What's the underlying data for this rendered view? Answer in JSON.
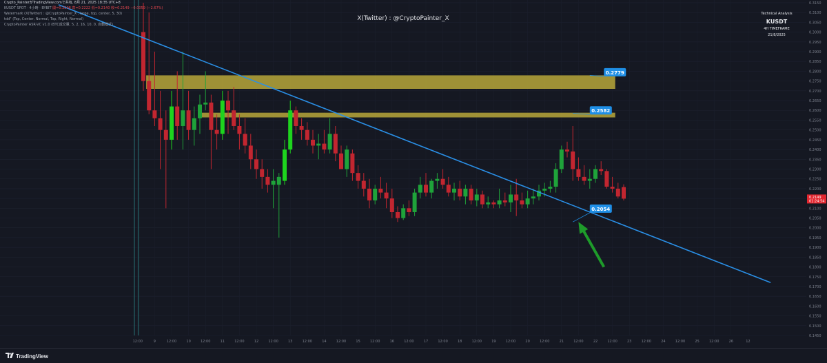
{
  "header": {
    "publisher": "Crypto_PainterがTradingView.comで共有, 8月 21, 2025 18:35 UTC+8",
    "symbol_line": "KUSDT SPOT · 4小時 · BYBIT",
    "ohlc": "開=0.2208 高=0.2222 低=0.2140 收=0.2149 −0.0059 (−2.67%)",
    "indicator_1": "Watermark (X(Twitter) : @CryptoPainter_X , large, top, center, 5, 30)",
    "indicator_2": "tdd\" (Top, Center, Normal, Top, Right, Normal)",
    "indicator_3": "CryptoPainter ASR-VC v1.0 (BTC成交量, 5, 2, 16, 10, 0, 自動模式)"
  },
  "watermark": "X(Twitter) : @CryptoPainter_X",
  "ta_box": {
    "title": "Technical Analysis",
    "symbol": "KUSDT",
    "timeframe": "4H TIMEFRAME",
    "date": "21/8/2025"
  },
  "footer": {
    "brand": "TradingView",
    "logo_icon": "tradingview-logo-icon"
  },
  "colors": {
    "up": "#1fa33a",
    "up_bright": "#1ed41e",
    "down": "#c22630",
    "trendline": "#2a8fe6",
    "zone": "#b7a73a",
    "label_bg": "#1f8fe6",
    "price_tag": "#e3262f",
    "arrow": "#1e9b2a"
  },
  "chart_data": {
    "type": "candlestick",
    "title": "",
    "ylim": [
      0.145,
      0.3164
    ],
    "y_ticks": [
      0.145,
      0.15,
      0.155,
      0.16,
      0.165,
      0.17,
      0.175,
      0.18,
      0.185,
      0.19,
      0.195,
      0.2,
      0.205,
      0.21,
      0.215,
      0.22,
      0.225,
      0.23,
      0.235,
      0.24,
      0.245,
      0.25,
      0.255,
      0.26,
      0.265,
      0.27,
      0.275,
      0.28,
      0.285,
      0.29,
      0.295,
      0.3,
      0.305,
      0.31,
      0.315
    ],
    "x_ticks": [
      {
        "label": "12:00",
        "idx": -1
      },
      {
        "label": "9",
        "idx": 2
      },
      {
        "label": "12:00",
        "idx": 5
      },
      {
        "label": "10",
        "idx": 8
      },
      {
        "label": "12:00",
        "idx": 11
      },
      {
        "label": "11",
        "idx": 14
      },
      {
        "label": "12:00",
        "idx": 17
      },
      {
        "label": "12",
        "idx": 20
      },
      {
        "label": "12:00",
        "idx": 23
      },
      {
        "label": "13",
        "idx": 26
      },
      {
        "label": "12:00",
        "idx": 29
      },
      {
        "label": "14",
        "idx": 32
      },
      {
        "label": "12:00",
        "idx": 35
      },
      {
        "label": "15",
        "idx": 38
      },
      {
        "label": "12:00",
        "idx": 41
      },
      {
        "label": "16",
        "idx": 44
      },
      {
        "label": "12:00",
        "idx": 47
      },
      {
        "label": "17",
        "idx": 50
      },
      {
        "label": "12:00",
        "idx": 53
      },
      {
        "label": "18",
        "idx": 56
      },
      {
        "label": "12:00",
        "idx": 59
      },
      {
        "label": "19",
        "idx": 62
      },
      {
        "label": "12:00",
        "idx": 65
      },
      {
        "label": "20",
        "idx": 68
      },
      {
        "label": "12:00",
        "idx": 71
      },
      {
        "label": "21",
        "idx": 74
      },
      {
        "label": "12:00",
        "idx": 77
      },
      {
        "label": "22",
        "idx": 80
      },
      {
        "label": "12:00",
        "idx": 83
      },
      {
        "label": "23",
        "idx": 86
      },
      {
        "label": "12:00",
        "idx": 89
      },
      {
        "label": "24",
        "idx": 92
      },
      {
        "label": "12:00",
        "idx": 95
      },
      {
        "label": "25",
        "idx": 98
      },
      {
        "label": "12:00",
        "idx": 101
      },
      {
        "label": "26",
        "idx": 104
      },
      {
        "label": "12",
        "idx": 107
      }
    ],
    "candles": [
      {
        "o": 0.3,
        "h": 0.315,
        "l": 0.27,
        "c": 0.275
      },
      {
        "o": 0.275,
        "h": 0.31,
        "l": 0.258,
        "c": 0.26
      },
      {
        "o": 0.26,
        "h": 0.29,
        "l": 0.252,
        "c": 0.256
      },
      {
        "o": 0.256,
        "h": 0.27,
        "l": 0.23,
        "c": 0.25
      },
      {
        "o": 0.25,
        "h": 0.26,
        "l": 0.21,
        "c": 0.245
      },
      {
        "o": 0.245,
        "h": 0.27,
        "l": 0.24,
        "c": 0.262
      },
      {
        "o": 0.262,
        "h": 0.28,
        "l": 0.245,
        "c": 0.252
      },
      {
        "o": 0.252,
        "h": 0.29,
        "l": 0.24,
        "c": 0.26
      },
      {
        "o": 0.26,
        "h": 0.27,
        "l": 0.245,
        "c": 0.25
      },
      {
        "o": 0.25,
        "h": 0.262,
        "l": 0.242,
        "c": 0.256
      },
      {
        "o": 0.256,
        "h": 0.268,
        "l": 0.248,
        "c": 0.263
      },
      {
        "o": 0.263,
        "h": 0.28,
        "l": 0.26,
        "c": 0.264
      },
      {
        "o": 0.264,
        "h": 0.268,
        "l": 0.23,
        "c": 0.25
      },
      {
        "o": 0.25,
        "h": 0.258,
        "l": 0.24,
        "c": 0.248
      },
      {
        "o": 0.248,
        "h": 0.27,
        "l": 0.245,
        "c": 0.265
      },
      {
        "o": 0.265,
        "h": 0.27,
        "l": 0.248,
        "c": 0.26
      },
      {
        "o": 0.26,
        "h": 0.272,
        "l": 0.25,
        "c": 0.252
      },
      {
        "o": 0.252,
        "h": 0.258,
        "l": 0.24,
        "c": 0.248
      },
      {
        "o": 0.248,
        "h": 0.256,
        "l": 0.238,
        "c": 0.242
      },
      {
        "o": 0.242,
        "h": 0.248,
        "l": 0.23,
        "c": 0.235
      },
      {
        "o": 0.235,
        "h": 0.24,
        "l": 0.225,
        "c": 0.23
      },
      {
        "o": 0.23,
        "h": 0.235,
        "l": 0.22,
        "c": 0.226
      },
      {
        "o": 0.226,
        "h": 0.23,
        "l": 0.218,
        "c": 0.222
      },
      {
        "o": 0.222,
        "h": 0.23,
        "l": 0.21,
        "c": 0.224
      },
      {
        "o": 0.222,
        "h": 0.228,
        "l": 0.195,
        "c": 0.226
      },
      {
        "o": 0.224,
        "h": 0.245,
        "l": 0.222,
        "c": 0.24
      },
      {
        "o": 0.24,
        "h": 0.265,
        "l": 0.238,
        "c": 0.26
      },
      {
        "o": 0.26,
        "h": 0.262,
        "l": 0.248,
        "c": 0.252
      },
      {
        "o": 0.252,
        "h": 0.256,
        "l": 0.245,
        "c": 0.25
      },
      {
        "o": 0.25,
        "h": 0.254,
        "l": 0.242,
        "c": 0.245
      },
      {
        "o": 0.245,
        "h": 0.25,
        "l": 0.238,
        "c": 0.242
      },
      {
        "o": 0.242,
        "h": 0.248,
        "l": 0.235,
        "c": 0.243
      },
      {
        "o": 0.243,
        "h": 0.25,
        "l": 0.238,
        "c": 0.24
      },
      {
        "o": 0.24,
        "h": 0.256,
        "l": 0.238,
        "c": 0.248
      },
      {
        "o": 0.248,
        "h": 0.252,
        "l": 0.234,
        "c": 0.238
      },
      {
        "o": 0.238,
        "h": 0.242,
        "l": 0.23,
        "c": 0.23
      },
      {
        "o": 0.23,
        "h": 0.242,
        "l": 0.226,
        "c": 0.24
      },
      {
        "o": 0.238,
        "h": 0.24,
        "l": 0.224,
        "c": 0.228
      },
      {
        "o": 0.228,
        "h": 0.232,
        "l": 0.22,
        "c": 0.224
      },
      {
        "o": 0.224,
        "h": 0.228,
        "l": 0.216,
        "c": 0.22
      },
      {
        "o": 0.22,
        "h": 0.225,
        "l": 0.21,
        "c": 0.214
      },
      {
        "o": 0.214,
        "h": 0.222,
        "l": 0.212,
        "c": 0.22
      },
      {
        "o": 0.22,
        "h": 0.226,
        "l": 0.215,
        "c": 0.218
      },
      {
        "o": 0.218,
        "h": 0.223,
        "l": 0.21,
        "c": 0.215
      },
      {
        "o": 0.215,
        "h": 0.22,
        "l": 0.205,
        "c": 0.208
      },
      {
        "o": 0.208,
        "h": 0.211,
        "l": 0.203,
        "c": 0.205
      },
      {
        "o": 0.205,
        "h": 0.212,
        "l": 0.204,
        "c": 0.21
      },
      {
        "o": 0.21,
        "h": 0.214,
        "l": 0.206,
        "c": 0.208
      },
      {
        "o": 0.208,
        "h": 0.22,
        "l": 0.206,
        "c": 0.218
      },
      {
        "o": 0.218,
        "h": 0.226,
        "l": 0.215,
        "c": 0.222
      },
      {
        "o": 0.222,
        "h": 0.228,
        "l": 0.216,
        "c": 0.218
      },
      {
        "o": 0.218,
        "h": 0.225,
        "l": 0.215,
        "c": 0.224
      },
      {
        "o": 0.224,
        "h": 0.228,
        "l": 0.22,
        "c": 0.225
      },
      {
        "o": 0.225,
        "h": 0.23,
        "l": 0.22,
        "c": 0.222
      },
      {
        "o": 0.222,
        "h": 0.226,
        "l": 0.216,
        "c": 0.218
      },
      {
        "o": 0.218,
        "h": 0.223,
        "l": 0.214,
        "c": 0.22
      },
      {
        "o": 0.22,
        "h": 0.224,
        "l": 0.214,
        "c": 0.216
      },
      {
        "o": 0.216,
        "h": 0.222,
        "l": 0.212,
        "c": 0.22
      },
      {
        "o": 0.22,
        "h": 0.222,
        "l": 0.212,
        "c": 0.214
      },
      {
        "o": 0.214,
        "h": 0.22,
        "l": 0.211,
        "c": 0.217
      },
      {
        "o": 0.217,
        "h": 0.219,
        "l": 0.21,
        "c": 0.212
      },
      {
        "o": 0.212,
        "h": 0.216,
        "l": 0.21,
        "c": 0.213
      },
      {
        "o": 0.213,
        "h": 0.214,
        "l": 0.21,
        "c": 0.212
      },
      {
        "o": 0.212,
        "h": 0.22,
        "l": 0.21,
        "c": 0.214
      },
      {
        "o": 0.214,
        "h": 0.218,
        "l": 0.211,
        "c": 0.213
      },
      {
        "o": 0.213,
        "h": 0.222,
        "l": 0.208,
        "c": 0.217
      },
      {
        "o": 0.217,
        "h": 0.225,
        "l": 0.206,
        "c": 0.214
      },
      {
        "o": 0.214,
        "h": 0.218,
        "l": 0.21,
        "c": 0.212
      },
      {
        "o": 0.212,
        "h": 0.219,
        "l": 0.21,
        "c": 0.215
      },
      {
        "o": 0.215,
        "h": 0.22,
        "l": 0.212,
        "c": 0.216
      },
      {
        "o": 0.216,
        "h": 0.222,
        "l": 0.214,
        "c": 0.219
      },
      {
        "o": 0.219,
        "h": 0.223,
        "l": 0.216,
        "c": 0.22
      },
      {
        "o": 0.22,
        "h": 0.224,
        "l": 0.218,
        "c": 0.221
      },
      {
        "o": 0.221,
        "h": 0.233,
        "l": 0.218,
        "c": 0.23
      },
      {
        "o": 0.23,
        "h": 0.242,
        "l": 0.228,
        "c": 0.24
      },
      {
        "o": 0.24,
        "h": 0.244,
        "l": 0.236,
        "c": 0.239
      },
      {
        "o": 0.239,
        "h": 0.252,
        "l": 0.224,
        "c": 0.23
      },
      {
        "o": 0.23,
        "h": 0.236,
        "l": 0.224,
        "c": 0.226
      },
      {
        "o": 0.226,
        "h": 0.232,
        "l": 0.222,
        "c": 0.224
      },
      {
        "o": 0.224,
        "h": 0.23,
        "l": 0.22,
        "c": 0.225
      },
      {
        "o": 0.225,
        "h": 0.232,
        "l": 0.223,
        "c": 0.23
      },
      {
        "o": 0.23,
        "h": 0.234,
        "l": 0.227,
        "c": 0.229
      },
      {
        "o": 0.229,
        "h": 0.23,
        "l": 0.22,
        "c": 0.221
      },
      {
        "o": 0.221,
        "h": 0.226,
        "l": 0.218,
        "c": 0.22
      },
      {
        "o": 0.22,
        "h": 0.223,
        "l": 0.215,
        "c": 0.216
      },
      {
        "o": 0.2208,
        "h": 0.2222,
        "l": 0.214,
        "c": 0.2149
      }
    ],
    "annotations": {
      "zones": [
        {
          "from_idx": 0.5,
          "to_idx": 83.5,
          "low": 0.271,
          "high": 0.2779
        },
        {
          "from_idx": 10.2,
          "to_idx": 83.5,
          "low": 0.2564,
          "high": 0.2588
        }
      ],
      "trendline": {
        "idx1": -15,
        "p1": 0.314,
        "idx2": 111,
        "p2": 0.172
      },
      "labels": [
        {
          "text": "0.2779",
          "idx": 81.5,
          "price": 0.2795,
          "anchor_idx": 79,
          "anchor_price": 0.2779
        },
        {
          "text": "0.2582",
          "idx": 79,
          "price": 0.26,
          "anchor_idx": 76,
          "anchor_price": 0.2585
        },
        {
          "text": "0.2054",
          "idx": 79,
          "price": 0.2098,
          "anchor_idx": 76,
          "anchor_price": 0.203
        }
      ],
      "arrow": {
        "from_idx": 81.5,
        "from_price": 0.18,
        "to_idx": 77,
        "to_price": 0.203
      },
      "last_price": "0.2149",
      "countdown": "01:24:54"
    }
  }
}
